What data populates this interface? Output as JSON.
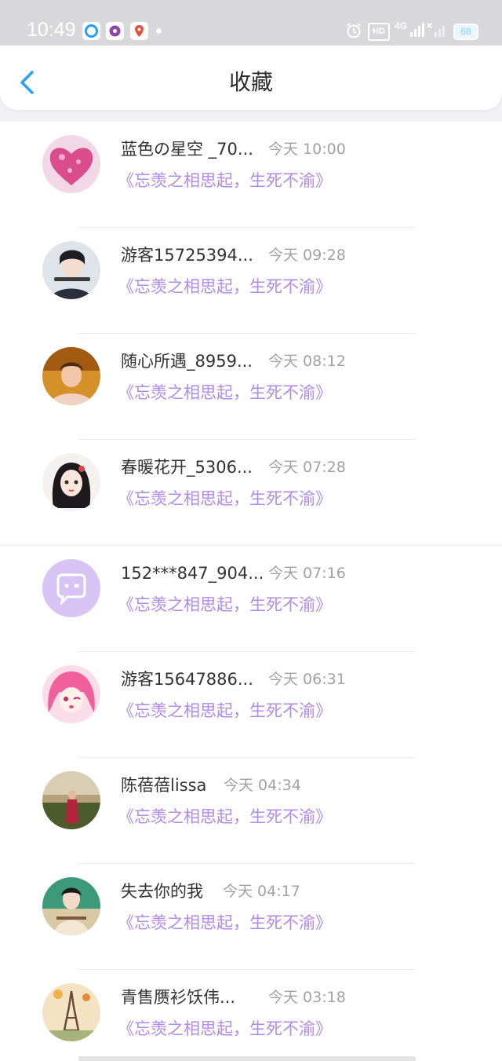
{
  "status_bar": {
    "time": "10:49",
    "hd_label": "HD",
    "network_label": "4G",
    "battery_level": "68",
    "apps": [
      "browser-app-icon",
      "music-app-icon",
      "map-app-icon"
    ]
  },
  "header": {
    "title": "收藏",
    "back_icon": "chevron-left-icon",
    "back_color": "#2a9df4"
  },
  "colors": {
    "subtitle": "#b28ae8",
    "time": "#a2a2a2",
    "name": "#333333"
  },
  "favorites": [
    {
      "name": "蓝色の星空 _70...",
      "time": "今天 10:00",
      "subtitle": "《忘羡之相思起，生死不渝》",
      "avatar": "pink-heart-avatar"
    },
    {
      "name": "游客15725394...",
      "time": "今天 09:28",
      "subtitle": "《忘羡之相思起，生死不渝》",
      "avatar": "flute-player-avatar"
    },
    {
      "name": "随心所遇_8959...",
      "time": "今天 08:12",
      "subtitle": "《忘羡之相思起，生死不渝》",
      "avatar": "selfie-avatar"
    },
    {
      "name": "春暖花开_5306...",
      "time": "今天 07:28",
      "subtitle": "《忘羡之相思起，生死不渝》",
      "avatar": "anime-girl-avatar"
    },
    {
      "name": "152***847_904...",
      "time": "今天 07:16",
      "subtitle": "《忘羡之相思起，生死不渝》",
      "avatar": "default-chat-avatar"
    },
    {
      "name": "游客15647886...",
      "time": "今天 06:31",
      "subtitle": "《忘羡之相思起，生死不渝》",
      "avatar": "pink-hair-anime-avatar"
    },
    {
      "name": "陈蓓蓓lissa",
      "time": "今天 04:34",
      "subtitle": "《忘羡之相思起，生死不渝》",
      "avatar": "photo-avatar"
    },
    {
      "name": "失去你的我",
      "time": "今天 04:17",
      "subtitle": "《忘羡之相思起，生死不渝》",
      "avatar": "traditional-costume-avatar"
    },
    {
      "name": "青售赝衫饫伟...",
      "time": "今天 03:18",
      "subtitle": "《忘羡之相思起，生死不渝》",
      "avatar": "eiffel-tower-avatar"
    }
  ]
}
